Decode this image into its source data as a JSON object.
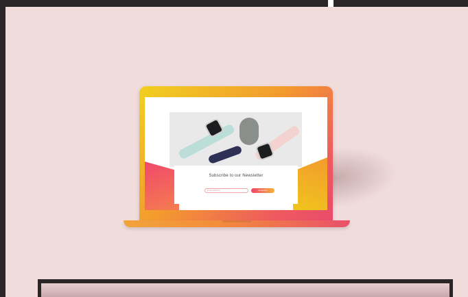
{
  "newsletter": {
    "title": "Subscribe to our Newsletter",
    "email_placeholder": "Email address",
    "subscribe_label": "Subscribe"
  },
  "colors": {
    "background": "#f1dcdc",
    "laptop_gradient_start": "#f0d11f",
    "laptop_gradient_end": "#e94a6b",
    "button_gradient_start": "#f0456d",
    "button_gradient_end": "#f7b13a"
  }
}
